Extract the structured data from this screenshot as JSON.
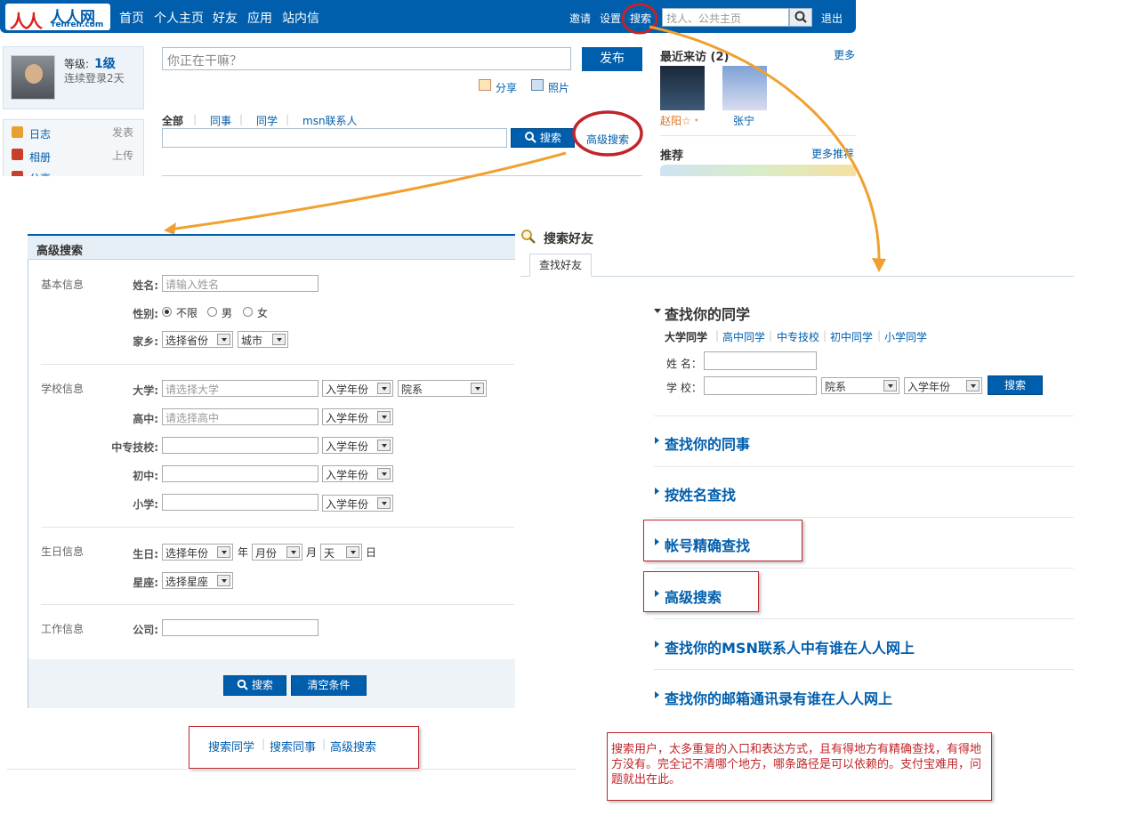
{
  "topnav": {
    "logo_name": "人人网",
    "logo_domain": "renren.com",
    "items": [
      "首页",
      "个人主页",
      "好友",
      "应用",
      "站内信"
    ],
    "invite": "邀请",
    "settings": "设置",
    "search": "搜索",
    "search_placeholder": "找人、公共主页",
    "logout": "退出"
  },
  "profile": {
    "level_label": "等级:",
    "level": "1级",
    "streak": "连续登录2天"
  },
  "sidebar": [
    {
      "label": "日志",
      "action": "发表"
    },
    {
      "label": "相册",
      "action": "上传"
    },
    {
      "label": "分享",
      "action": ""
    }
  ],
  "feed": {
    "status_placeholder": "你正在干嘛？",
    "publish": "发布",
    "share": "分享",
    "photo": "照片",
    "filters": [
      "全部",
      "同事",
      "同学",
      "msn联系人"
    ],
    "search_button": "搜索",
    "advanced_search": "高级搜索"
  },
  "recent_visitors": {
    "title": "最近来访 (2)",
    "more": "更多",
    "visitors": [
      "赵阳☆﹡",
      "张宁"
    ]
  },
  "recommend": {
    "title": "推荐",
    "more": "更多推荐"
  },
  "advanced_panel": {
    "title": "高级搜索",
    "basic_group": "基本信息",
    "name_label": "姓名:",
    "name_placeholder": "请输入姓名",
    "gender_label": "性别:",
    "gender_options": [
      "不限",
      "男",
      "女"
    ],
    "hometown_label": "家乡:",
    "province": "选择省份",
    "city": "城市",
    "school_group": "学校信息",
    "university_label": "大学:",
    "university_placeholder": "请选择大学",
    "enroll_year": "入学年份",
    "department": "院系",
    "highschool_label": "高中:",
    "highschool_placeholder": "请选择高中",
    "vocational_label": "中专技校:",
    "middle_label": "初中:",
    "primary_label": "小学:",
    "birthday_group": "生日信息",
    "birthday_label": "生日:",
    "year_select": "选择年份",
    "year_unit": "年",
    "month_select": "月份",
    "month_unit": "月",
    "day_select": "天",
    "day_unit": "日",
    "zodiac_label": "星座:",
    "zodiac_select": "选择星座",
    "work_group": "工作信息",
    "company_label": "公司:",
    "search_btn": "搜索",
    "clear_btn": "清空条件"
  },
  "bottom_links": [
    "搜索同学",
    "搜索同事",
    "高级搜索"
  ],
  "search_friends": {
    "title": "搜索好友",
    "tab": "查找好友",
    "classmates_title": "查找你的同学",
    "school_types": [
      "大学同学",
      "高中同学",
      "中专技校",
      "初中同学",
      "小学同学"
    ],
    "name_label": "姓 名：",
    "school_label": "学 校：",
    "department": "院系",
    "enroll_year": "入学年份",
    "search": "搜索",
    "sections": [
      "查找你的同事",
      "按姓名查找",
      "帐号精确查找",
      "高级搜索",
      "查找你的MSN联系人中有谁在人人网上",
      "查找你的邮箱通讯录有谁在人人网上"
    ]
  },
  "note": "搜索用户，太多重复的入口和表达方式，且有得地方有精确查找，有得地方没有。完全记不清哪个地方，哪条路径是可以依赖的。支付宝难用，问题就出在此。",
  "colors": {
    "brand_blue": "#005eac",
    "annotation_red": "#c0252a",
    "arrow_orange": "#f0a030"
  }
}
